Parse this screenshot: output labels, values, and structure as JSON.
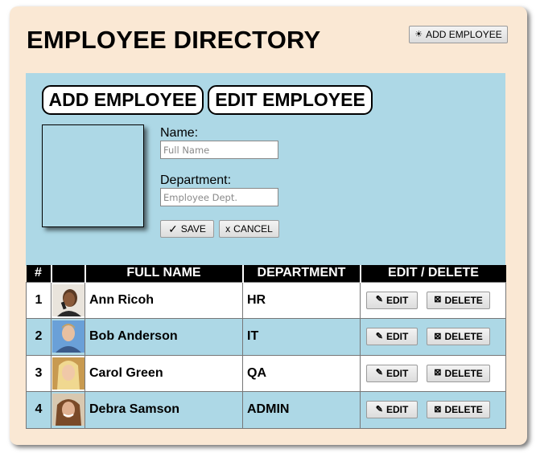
{
  "header": {
    "title": "EMPLOYEE DIRECTORY",
    "add_button_label": "ADD EMPLOYEE",
    "add_button_icon": "sun-icon"
  },
  "tabs": [
    {
      "label": "ADD EMPLOYEE"
    },
    {
      "label": "EDIT EMPLOYEE"
    }
  ],
  "form": {
    "name_label": "Name:",
    "name_placeholder": "Full Name",
    "name_value": "",
    "dept_label": "Department:",
    "dept_placeholder": "Employee Dept.",
    "dept_value": "",
    "save_icon": "✓",
    "save_label": "SAVE",
    "cancel_icon": "x",
    "cancel_label": "CANCEL"
  },
  "table": {
    "columns": [
      "#",
      "",
      "FULL NAME",
      "DEPARTMENT",
      "EDIT / DELETE"
    ],
    "edit_label": "EDIT",
    "delete_label": "DELETE",
    "rows": [
      {
        "num": "1",
        "name": "Ann Ricoh",
        "department": "HR"
      },
      {
        "num": "2",
        "name": "Bob Anderson",
        "department": "IT"
      },
      {
        "num": "3",
        "name": "Carol Green",
        "department": "QA"
      },
      {
        "num": "4",
        "name": "Debra Samson",
        "department": "ADMIN"
      }
    ]
  },
  "colors": {
    "panel_bg": "#fae8d4",
    "form_bg": "#add8e6",
    "header_bg": "#000000",
    "alt_row_bg": "#add8e6"
  }
}
